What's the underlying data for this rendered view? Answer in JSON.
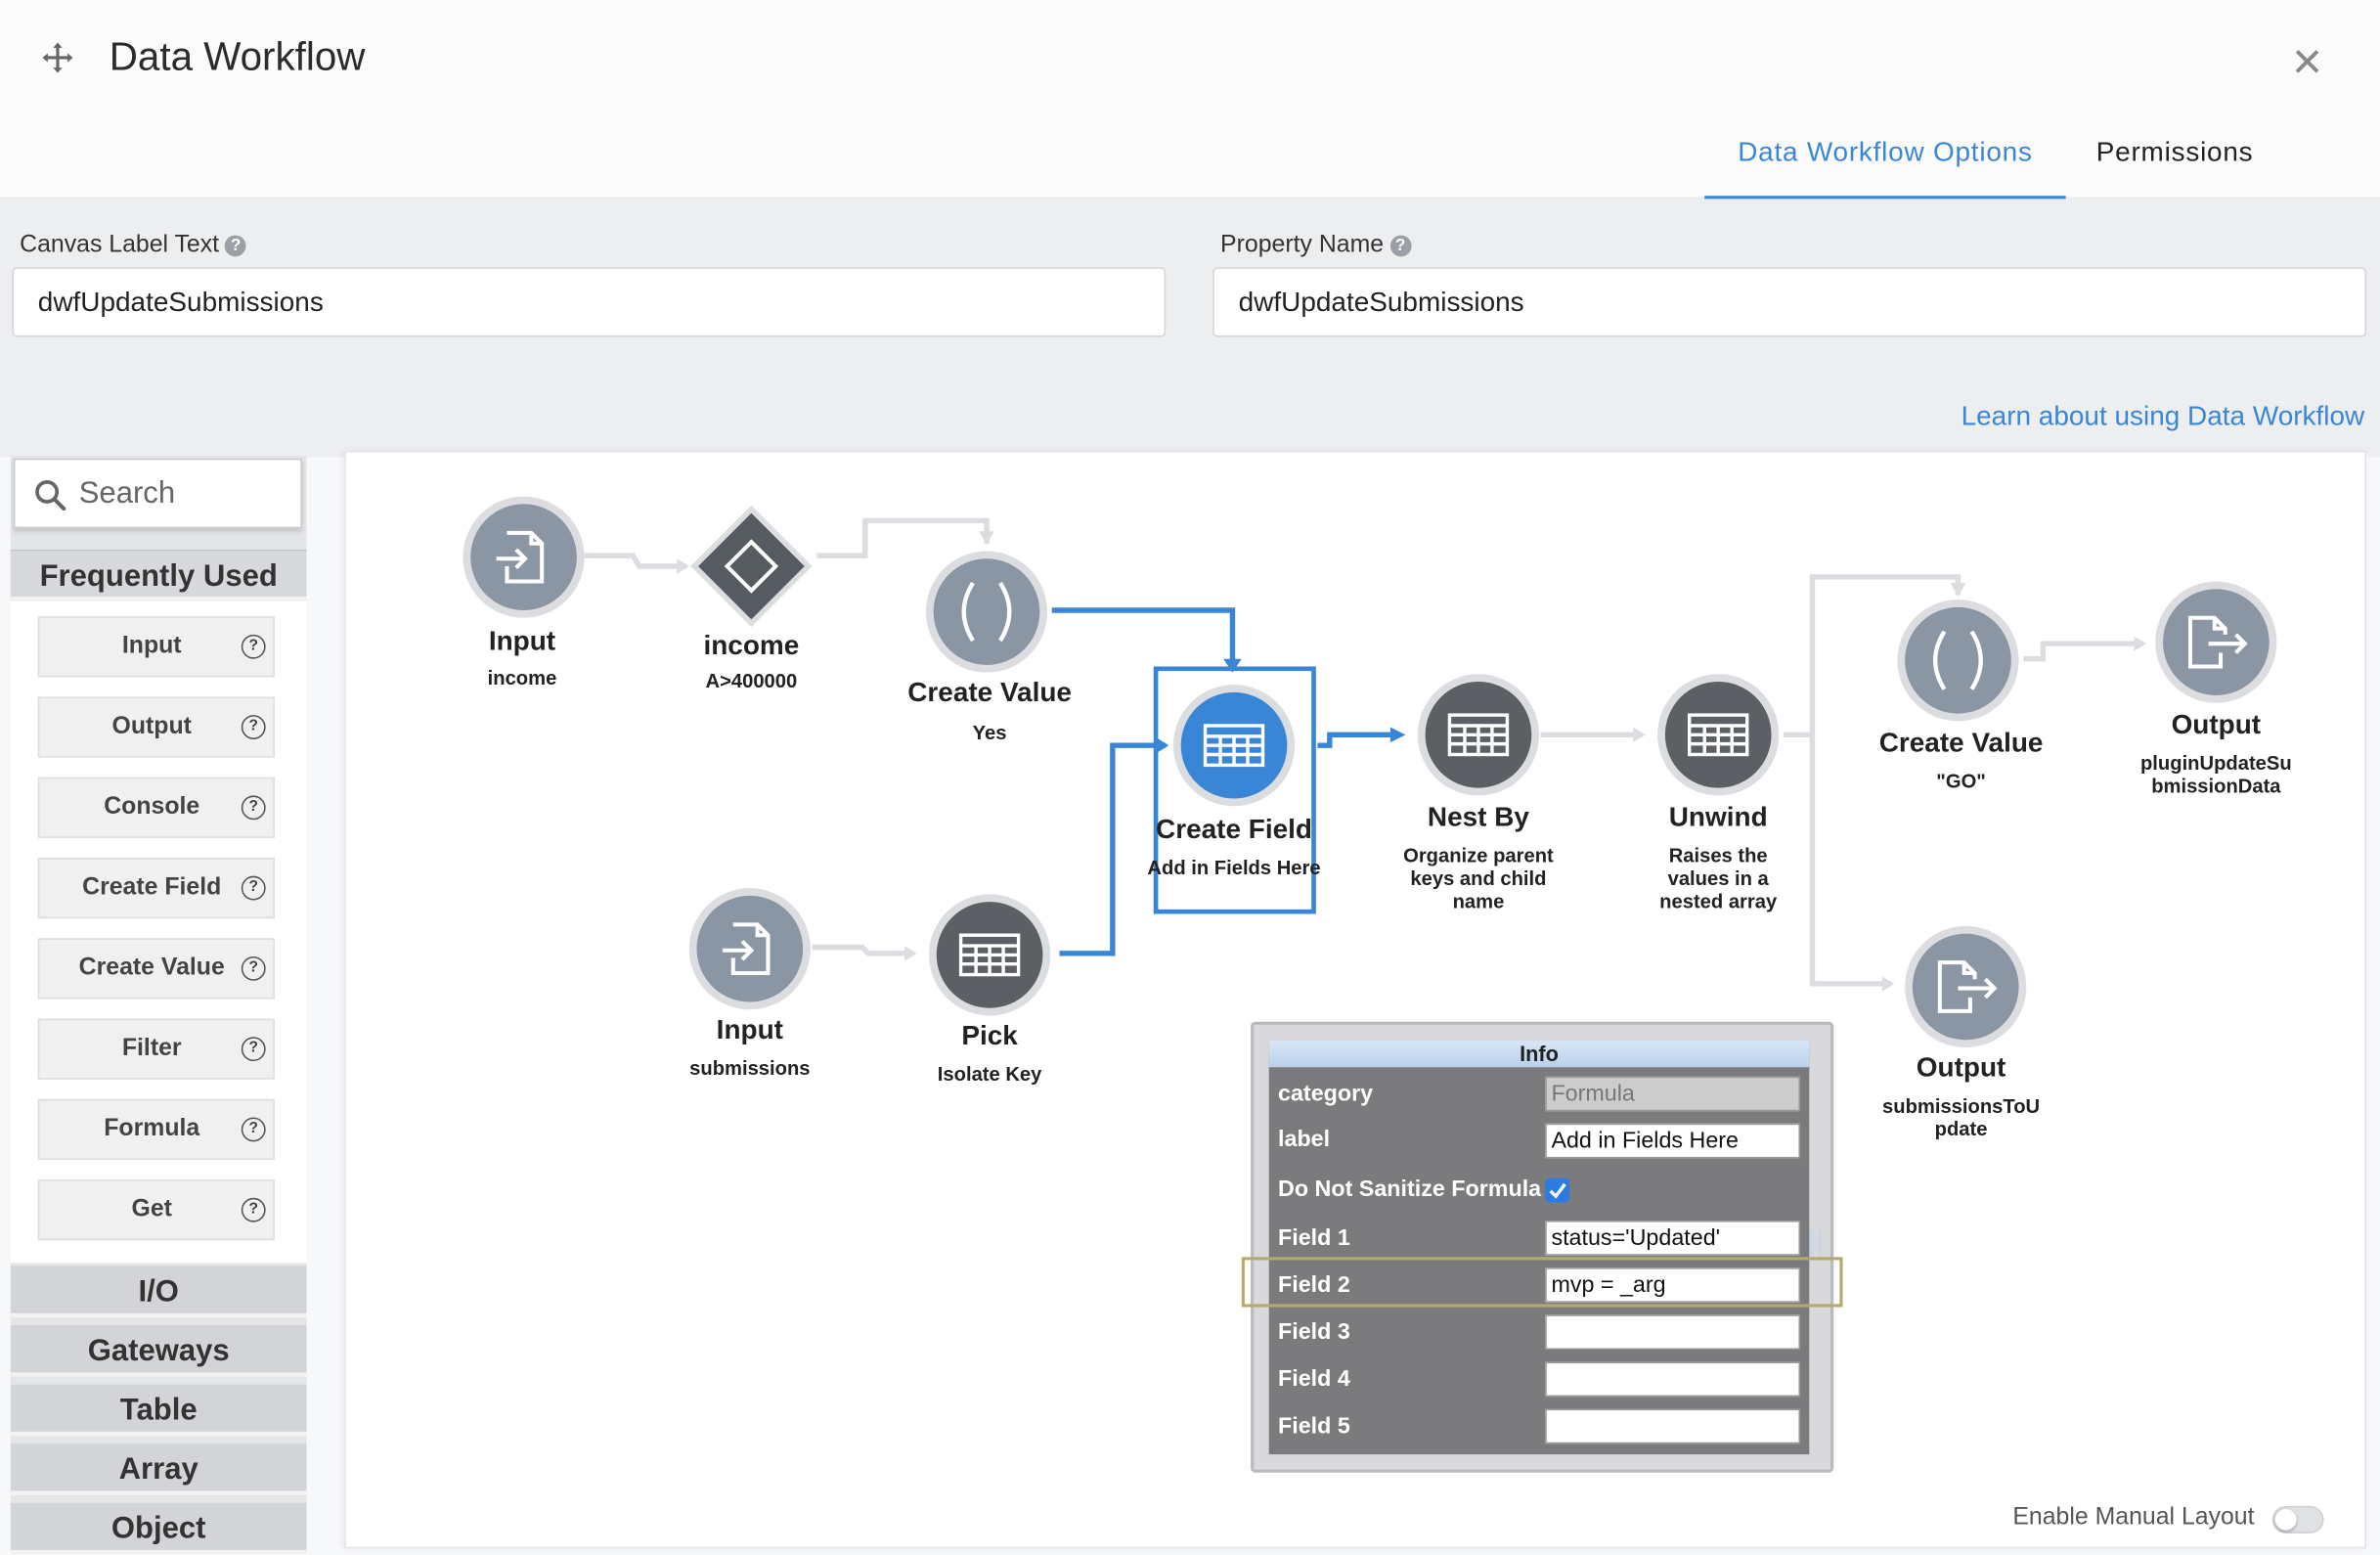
{
  "window": {
    "title": "Data Workflow",
    "tabs": [
      {
        "label": "Data Workflow Options",
        "active": true
      },
      {
        "label": "Permissions",
        "active": false
      }
    ]
  },
  "properties": {
    "canvas_label": {
      "label": "Canvas Label Text",
      "value": "dwfUpdateSubmissions"
    },
    "property_name": {
      "label": "Property Name",
      "value": "dwfUpdateSubmissions"
    },
    "learn_link": "Learn about using Data Workflow"
  },
  "palette": {
    "search_placeholder": "Search",
    "frequently_used": "Frequently Used",
    "items": [
      "Input",
      "Output",
      "Console",
      "Create Field",
      "Create Value",
      "Filter",
      "Formula",
      "Get"
    ],
    "help_glyph": "?",
    "sections": [
      "I/O",
      "Gateways",
      "Table",
      "Array",
      "Object"
    ]
  },
  "nodes": {
    "input_income": {
      "name": "Input",
      "desc": "income",
      "icon": "input-icon",
      "color": "#8a96a3"
    },
    "gateway_income": {
      "name": "income",
      "desc": "A>400000",
      "icon": "diamond-icon",
      "color": "#555b61"
    },
    "create_value_yes": {
      "name": "Create Value",
      "desc": "Yes",
      "icon": "parentheses-icon",
      "color": "#8a96a3"
    },
    "create_field": {
      "name": "Create Field",
      "desc": "Add in Fields Here",
      "icon": "table-icon",
      "color": "#3a86d6"
    },
    "nest_by": {
      "name": "Nest By",
      "desc": "Organize parent keys and child name",
      "icon": "table-icon",
      "color": "#5c5f63"
    },
    "unwind": {
      "name": "Unwind",
      "desc": "Raises the values in a nested array",
      "icon": "table-icon",
      "color": "#5c5f63"
    },
    "create_value_go": {
      "name": "Create Value",
      "desc": "\"GO\"",
      "icon": "parentheses-icon",
      "color": "#8a96a3"
    },
    "output_plugin": {
      "name": "Output",
      "desc": "pluginUpdateSubmissionData",
      "desc_lines": [
        "pluginUpdateSu",
        "bmissionData"
      ],
      "icon": "output-icon",
      "color": "#8a96a3"
    },
    "input_submissions": {
      "name": "Input",
      "desc": "submissions",
      "icon": "input-icon",
      "color": "#8a96a3"
    },
    "pick": {
      "name": "Pick",
      "desc": "Isolate Key",
      "icon": "table-icon",
      "color": "#5c5f63"
    },
    "output_submissions": {
      "name": "Output",
      "desc": "submissionsToUpdate",
      "desc_lines": [
        "submissionsToU",
        "pdate"
      ],
      "icon": "output-icon",
      "color": "#8a96a3"
    }
  },
  "info_panel": {
    "title": "Info",
    "rows": [
      {
        "label": "category",
        "value": "Formula",
        "disabled": true
      },
      {
        "label": "label",
        "value": "Add in Fields Here"
      },
      {
        "label": "Do Not Sanitize Formula",
        "checked": true
      },
      {
        "label": "Field 1",
        "value": "status='Updated'"
      },
      {
        "label": "Field 2",
        "value": "mvp = _arg"
      },
      {
        "label": "Field 3",
        "value": ""
      },
      {
        "label": "Field 4",
        "value": ""
      },
      {
        "label": "Field 5",
        "value": ""
      }
    ]
  },
  "canvas_footer": {
    "manual_layout": "Enable Manual Layout",
    "manual_layout_on": false
  },
  "colors": {
    "accent": "#3a86d6",
    "node_light": "#8a96a3",
    "node_dark": "#5c5f63"
  }
}
